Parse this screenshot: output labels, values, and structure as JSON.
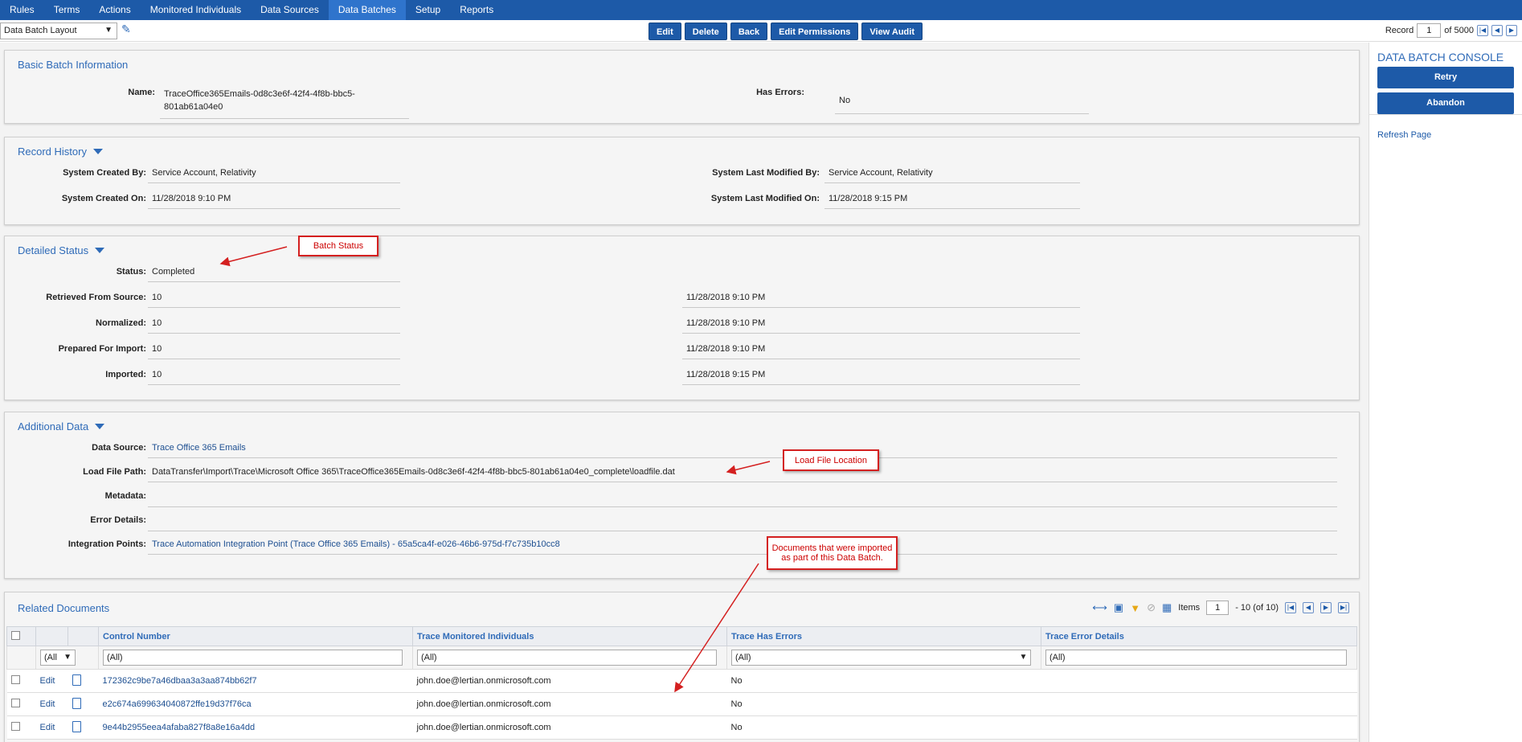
{
  "nav": {
    "tabs": [
      {
        "label": "Rules"
      },
      {
        "label": "Terms"
      },
      {
        "label": "Actions"
      },
      {
        "label": "Monitored Individuals"
      },
      {
        "label": "Data Sources"
      },
      {
        "label": "Data Batches",
        "active": true
      },
      {
        "label": "Setup"
      },
      {
        "label": "Reports"
      }
    ]
  },
  "toolbar": {
    "layout": "Data Batch Layout",
    "edit": "Edit",
    "delete": "Delete",
    "back": "Back",
    "edit_permissions": "Edit Permissions",
    "view_audit": "View Audit",
    "record_label": "Record",
    "record_value": "1",
    "record_of": "of 5000"
  },
  "basic": {
    "title": "Basic Batch Information",
    "name_label": "Name:",
    "name_value_1": "TraceOffice365Emails-0d8c3e6f-42f4-4f8b-bbc5-",
    "name_value_2": "801ab61a04e0",
    "errors_label": "Has Errors:",
    "errors_value": "No"
  },
  "history": {
    "title": "Record History",
    "created_by_label": "System Created By:",
    "created_by": "Service Account, Relativity",
    "created_on_label": "System Created On:",
    "created_on": "11/28/2018 9:10 PM",
    "modified_by_label": "System Last Modified By:",
    "modified_by": "Service Account, Relativity",
    "modified_on_label": "System Last Modified On:",
    "modified_on": "11/28/2018 9:15 PM"
  },
  "status": {
    "title": "Detailed Status",
    "status_label": "Status:",
    "status_value": "Completed",
    "rows": [
      {
        "label": "Retrieved From Source:",
        "count": "10",
        "time": "11/28/2018 9:10 PM"
      },
      {
        "label": "Normalized:",
        "count": "10",
        "time": "11/28/2018 9:10 PM"
      },
      {
        "label": "Prepared For Import:",
        "count": "10",
        "time": "11/28/2018 9:10 PM"
      },
      {
        "label": "Imported:",
        "count": "10",
        "time": "11/28/2018 9:15 PM"
      }
    ]
  },
  "additional": {
    "title": "Additional Data",
    "source_label": "Data Source:",
    "source_value": "Trace Office 365 Emails",
    "path_label": "Load File Path:",
    "path_value": "DataTransfer\\Import\\Trace\\Microsoft Office 365\\TraceOffice365Emails-0d8c3e6f-42f4-4f8b-bbc5-801ab61a04e0_complete\\loadfile.dat",
    "metadata_label": "Metadata:",
    "error_label": "Error Details:",
    "ip_label": "Integration Points:",
    "ip_value": "Trace Automation Integration Point (Trace Office 365 Emails) - 65a5ca4f-e026-46b6-975d-f7c735b10cc8"
  },
  "related": {
    "title": "Related Documents",
    "items_label": "Items",
    "items_value": "1",
    "items_range": "- 10 (of 10)",
    "columns": [
      "Control Number",
      "Trace Monitored Individuals",
      "Trace Has Errors",
      "Trace Error Details"
    ],
    "filter_small": "(All",
    "filter_all": "(All)",
    "edit_label": "Edit",
    "rows": [
      {
        "control": "172362c9be7a46dbaa3a3aa874bb62f7",
        "individual": "john.doe@lertian.onmicrosoft.com",
        "errors": "No"
      },
      {
        "control": "e2c674a699634040872ffe19d37f76ca",
        "individual": "john.doe@lertian.onmicrosoft.com",
        "errors": "No"
      },
      {
        "control": "9e44b2955eea4afaba827f8a8e16a4dd",
        "individual": "john.doe@lertian.onmicrosoft.com",
        "errors": "No"
      }
    ]
  },
  "console": {
    "title": "DATA BATCH CONSOLE",
    "retry": "Retry",
    "abandon": "Abandon",
    "refresh": "Refresh Page"
  },
  "annotations": {
    "batch_status": "Batch Status",
    "load_file": "Load File Location",
    "docs_1": "Documents that were imported",
    "docs_2": "as part of this Data Batch."
  }
}
